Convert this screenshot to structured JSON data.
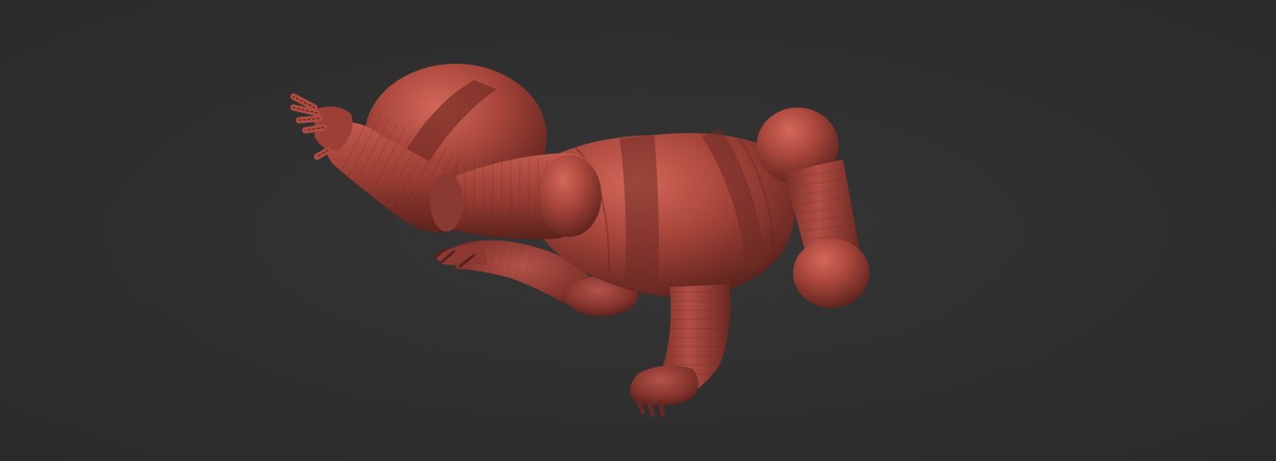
{
  "viewport": {
    "background_color": "#2e2e2e",
    "subject": "sculpt-model",
    "material_color": "#a8443a",
    "band_color": "#6e2c26"
  }
}
